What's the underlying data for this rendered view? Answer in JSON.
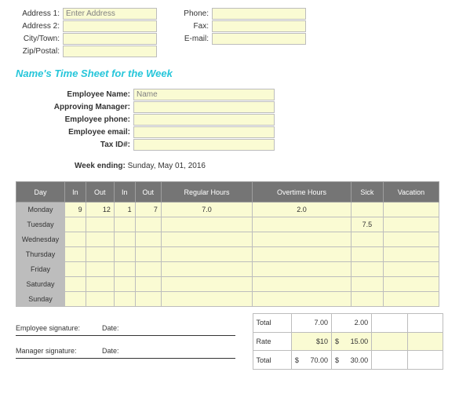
{
  "contact": {
    "address1_label": "Address 1:",
    "address1_value": "Enter Address",
    "address2_label": "Address 2:",
    "city_label": "City/Town:",
    "zip_label": "Zip/Postal:",
    "phone_label": "Phone:",
    "fax_label": "Fax:",
    "email_label": "E-mail:"
  },
  "title": "Name's Time Sheet for the Week",
  "employee": {
    "name_label": "Employee Name:",
    "name_value": "Name",
    "manager_label": "Approving Manager:",
    "phone_label": "Employee phone:",
    "email_label": "Employee email:",
    "taxid_label": "Tax ID#:"
  },
  "week_ending": {
    "label": "Week ending:",
    "value": "Sunday, May 01, 2016"
  },
  "headers": {
    "day": "Day",
    "in1": "In",
    "out1": "Out",
    "in2": "In",
    "out2": "Out",
    "regular": "Regular Hours",
    "overtime": "Overtime Hours",
    "sick": "Sick",
    "vacation": "Vacation"
  },
  "days": {
    "mon": "Monday",
    "tue": "Tuesday",
    "wed": "Wednesday",
    "thu": "Thursday",
    "fri": "Friday",
    "sat": "Saturday",
    "sun": "Sunday"
  },
  "rows": {
    "mon": {
      "in1": "9",
      "out1": "12",
      "in2": "1",
      "out2": "7",
      "reg": "7.0",
      "ot": "2.0",
      "sick": "",
      "vac": ""
    },
    "tue": {
      "sick": "7.5"
    }
  },
  "summary": {
    "total_label": "Total",
    "rate_label": "Rate",
    "total_reg": "7.00",
    "total_ot": "2.00",
    "rate_reg": "$10",
    "rate_ot_sym": "$",
    "rate_ot_val": "15.00",
    "grand_reg_sym": "$",
    "grand_reg_val": "70.00",
    "grand_ot_sym": "$",
    "grand_ot_val": "30.00"
  },
  "signatures": {
    "emp_label": "Employee signature:",
    "mgr_label": "Manager signature:",
    "date_label": "Date:"
  }
}
